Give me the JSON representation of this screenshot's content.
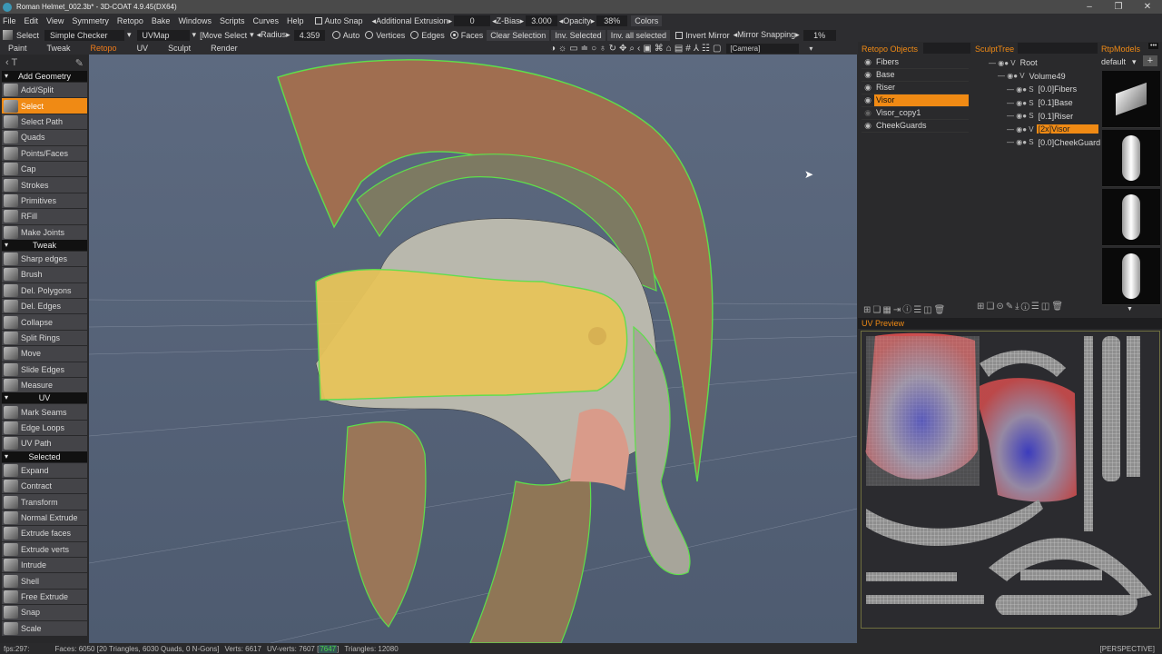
{
  "window": {
    "title": "Roman Helmet_002.3b* - 3D-COAT 4.9.45(DX64)",
    "minimize": "–",
    "restore": "❐",
    "close": "✕"
  },
  "menu": [
    "File",
    "Edit",
    "View",
    "Symmetry",
    "Retopo",
    "Bake",
    "Windows",
    "Scripts",
    "Curves",
    "Help"
  ],
  "toolbar1": {
    "auto_snap": "Auto Snap",
    "additional_extrusion_label": "◂Additional Extrusion▸",
    "additional_extrusion_value": "0",
    "zbias_label": "◂Z-Bias▸",
    "zbias_value": "3.000",
    "opacity_label": "◂Opacity▸",
    "opacity_value": "38%",
    "colors_button": "Colors"
  },
  "toolbar2": {
    "select_label": "Select",
    "shader": "Simple  Checker",
    "uvmap": "UVMap",
    "move_select": "[Move  Select",
    "radius_label": "◂Radius▸",
    "radius_value": "4.359",
    "auto": "Auto",
    "vertices": "Vertices",
    "edges": "Edges",
    "faces": "Faces",
    "selected_mode": "faces",
    "clear_selection": "Clear  Selection",
    "inv_selected": "Inv.  Selected",
    "inv_all_selected": "Inv.  all  selected",
    "invert_mirror": "Invert  Mirror",
    "mirror_snapping_label": "◂Mirror  Snapping▸",
    "mirror_snapping_value": "1%"
  },
  "rooms": [
    {
      "label": "Paint",
      "active": false
    },
    {
      "label": "Tweak",
      "active": false
    },
    {
      "label": "Retopo",
      "active": true
    },
    {
      "label": "UV",
      "active": false
    },
    {
      "label": "Sculpt",
      "active": false
    },
    {
      "label": "Render",
      "active": false
    }
  ],
  "viewport_icons": [
    "◑",
    "☼",
    "▭",
    "≐",
    "○",
    "♁",
    "↻",
    "✥",
    "⌕",
    "‹",
    "▣",
    "⌘",
    "⌂",
    "▤",
    "#",
    "⅄",
    "☷",
    "▢"
  ],
  "camera": "[Camera]",
  "tools": {
    "sections": [
      {
        "title": "Add Geometry",
        "items": [
          "Add/Split",
          "Select",
          "Select Path",
          "Quads",
          "Points/Faces",
          "Cap",
          "Strokes",
          "Primitives",
          "RFill",
          "Make Joints"
        ]
      },
      {
        "title": "Tweak",
        "items": [
          "Sharp edges",
          "Brush",
          "Del. Polygons",
          "Del. Edges",
          "Collapse",
          "Split Rings",
          "Move",
          "Slide Edges",
          "Measure"
        ]
      },
      {
        "title": "UV",
        "items": [
          "Mark Seams",
          "Edge Loops",
          "UV Path"
        ]
      },
      {
        "title": "Selected",
        "items": [
          "Expand",
          "Contract",
          "Transform",
          "Normal Extrude",
          "Extrude faces",
          "Extrude verts",
          "Intrude",
          "Shell",
          "Free Extrude",
          "Snap",
          "Scale"
        ]
      }
    ],
    "active": "Select"
  },
  "retopo_objects": {
    "title": "Retopo  Objects",
    "items": [
      {
        "name": "Fibers",
        "visible": true,
        "selected": false
      },
      {
        "name": "Base",
        "visible": true,
        "selected": false
      },
      {
        "name": "Riser",
        "visible": true,
        "selected": false
      },
      {
        "name": "Visor",
        "visible": true,
        "selected": true
      },
      {
        "name": "Visor_copy1",
        "visible": false,
        "selected": false
      },
      {
        "name": "CheekGuards",
        "visible": true,
        "selected": false
      }
    ]
  },
  "sculpt_tree": {
    "title": "SculptTree",
    "items": [
      {
        "type": "V",
        "name": "Root",
        "depth": 0
      },
      {
        "type": "V",
        "name": "Volume49",
        "depth": 1
      },
      {
        "type": "S",
        "name": "[0.0]Fibers",
        "depth": 2
      },
      {
        "type": "S",
        "name": "[0.1]Base",
        "depth": 2
      },
      {
        "type": "S",
        "name": "[0.1]Riser",
        "depth": 2
      },
      {
        "type": "V",
        "name": "[2x]Visor",
        "depth": 2,
        "selected": true
      },
      {
        "type": "S",
        "name": "[0.0]CheekGuard",
        "depth": 2
      }
    ]
  },
  "rtp_models": {
    "title": "RtpModels",
    "preset": "default",
    "add": "+",
    "more": "•••"
  },
  "uv_preview": {
    "title": "UV Preview"
  },
  "status": {
    "fps": "fps:297:",
    "faces": "Faces: 6050 [20 Triangles, 6030 Quads, 0 N-Gons]",
    "verts": "Verts: 6617",
    "uv_verts": "UV-verts: 7607 [",
    "uv_verts_hl": "7647",
    "uv_verts_end": "]",
    "triangles": "Triangles: 12080",
    "view_mode": "[PERSPECTIVE]"
  },
  "colors": {
    "accent": "#f08a14",
    "selection_edge": "#5ee04a"
  }
}
